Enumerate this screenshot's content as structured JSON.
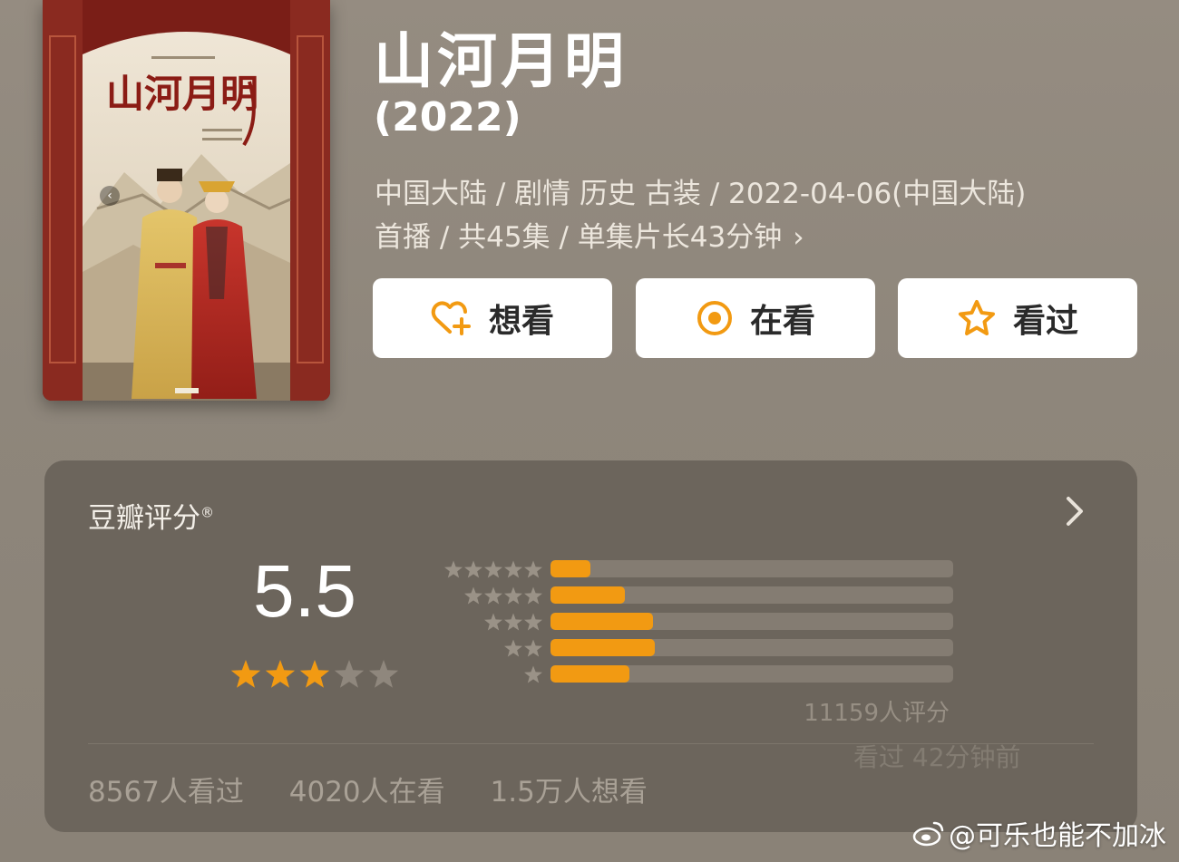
{
  "title": "山河月明",
  "year": "(2022)",
  "meta_line1": "中国大陆 / 剧情 历史 古装 / 2022-04-06(中国大陆)",
  "meta_line2": "首播 / 共45集 / 单集片长43分钟",
  "actions": [
    {
      "label": "想看",
      "icon": "heart-plus-icon"
    },
    {
      "label": "在看",
      "icon": "target-circle-icon"
    },
    {
      "label": "看过",
      "icon": "star-outline-icon"
    }
  ],
  "poster": {
    "title_art": "山河月明"
  },
  "rating": {
    "title": "豆瓣评分",
    "registered": "®",
    "score": "5.5",
    "star_level": 3,
    "distribution": [
      {
        "stars": 5,
        "percent": 10
      },
      {
        "stars": 4,
        "percent": 18.5
      },
      {
        "stars": 3,
        "percent": 25.5
      },
      {
        "stars": 2,
        "percent": 26
      },
      {
        "stars": 1,
        "percent": 19.5
      }
    ],
    "count": "11159人评分",
    "ghost_text": "看过  42分钟前"
  },
  "stats": {
    "watched": "8567人看过",
    "watching": "4020人在看",
    "want": "1.5万人想看"
  },
  "watermark": "@可乐也能不加冰",
  "colors": {
    "accent": "#f29a12",
    "card_bg": "#6c655c",
    "page_bg": "#8f877c"
  }
}
